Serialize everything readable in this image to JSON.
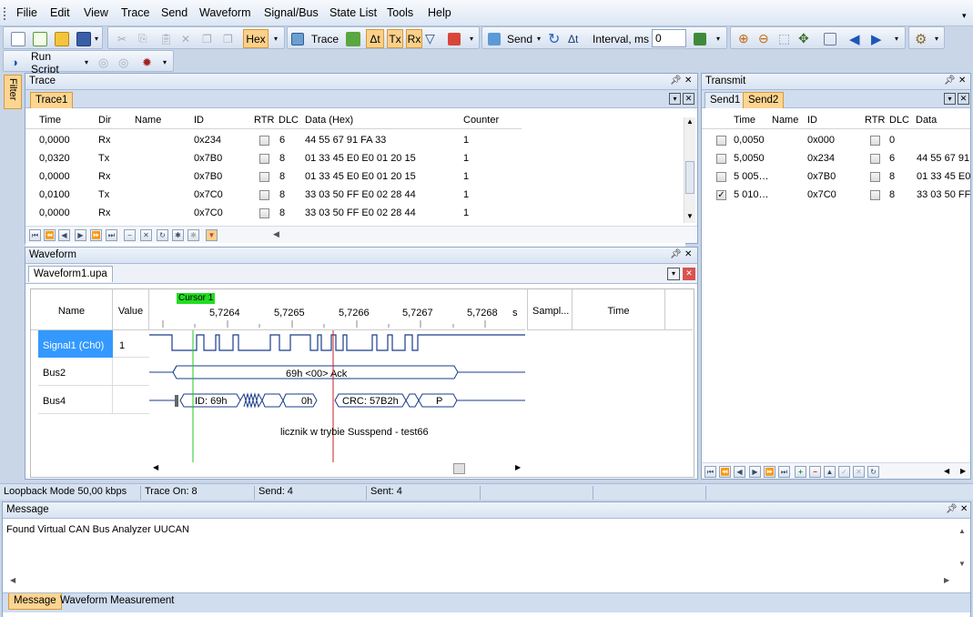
{
  "menu": {
    "items": [
      "Filie",
      "Edit",
      "View",
      "Trace",
      "Send",
      "Waveform",
      "Signal/Bus",
      "State List",
      "Tools",
      "Help"
    ]
  },
  "toolbar": {
    "hex": "Hex",
    "trace": "Trace",
    "tx": "Tx",
    "rx": "Rx",
    "send": "Send",
    "interval_label": "Interval, ms",
    "interval_value": "0",
    "run_script": "Run Script"
  },
  "filter_tab": "Filter",
  "trace_panel": {
    "title": "Trace",
    "tab": "Trace1",
    "columns": [
      "Time",
      "Dir",
      "Name",
      "ID",
      "RTR",
      "DLC",
      "Data (Hex)",
      "Counter"
    ],
    "rows": [
      {
        "time": "0,0000",
        "dir": "Rx",
        "name": "",
        "id": "0x234",
        "dlc": "6",
        "data": "44 55 67 91 FA 33",
        "counter": "1"
      },
      {
        "time": "0,0320",
        "dir": "Tx",
        "name": "",
        "id": "0x7B0",
        "dlc": "8",
        "data": "01 33 45 E0 E0 01 20 15",
        "counter": "1"
      },
      {
        "time": "0,0000",
        "dir": "Rx",
        "name": "",
        "id": "0x7B0",
        "dlc": "8",
        "data": "01 33 45 E0 E0 01 20 15",
        "counter": "1"
      },
      {
        "time": "0,0100",
        "dir": "Tx",
        "name": "",
        "id": "0x7C0",
        "dlc": "8",
        "data": "33 03 50 FF E0 02 28 44",
        "counter": "1"
      },
      {
        "time": "0,0000",
        "dir": "Rx",
        "name": "",
        "id": "0x7C0",
        "dlc": "8",
        "data": "33 03 50 FF E0 02 28 44",
        "counter": "1"
      }
    ]
  },
  "waveform_panel": {
    "title": "Waveform",
    "tab": "Waveform1.upa",
    "cursor": "Cursor 1",
    "col_name": "Name",
    "col_value": "Value",
    "col_sample": "Sampl...",
    "col_time": "Time",
    "ticks": [
      "5,7264",
      "5,7265",
      "5,7266",
      "5,7267",
      "5,7268"
    ],
    "unit": "s",
    "signals": [
      {
        "name": "Signal1 (Ch0)",
        "value": "1"
      },
      {
        "name": "Bus2",
        "value": ""
      },
      {
        "name": "Bus4",
        "value": ""
      }
    ],
    "bus2_label": "69h <00> Ack",
    "bus4_id": "ID: 69h",
    "bus4_data": "0h",
    "bus4_crc": "CRC: 57B2h",
    "bus4_p": "P",
    "note": "licznik w trybie Susspend - test66"
  },
  "transmit_panel": {
    "title": "Transmit",
    "tabs": [
      "Send1",
      "Send2"
    ],
    "columns": [
      "Time",
      "Name",
      "ID",
      "RTR",
      "DLC",
      "Data"
    ],
    "rows": [
      {
        "checked": false,
        "time": "0,0050",
        "name": "",
        "id": "0x000",
        "rtr": false,
        "dlc": "0",
        "data": ""
      },
      {
        "checked": false,
        "time": "5,0050",
        "name": "",
        "id": "0x234",
        "rtr": false,
        "dlc": "6",
        "data": "44 55 67 91"
      },
      {
        "checked": false,
        "time": "5 005…",
        "name": "",
        "id": "0x7B0",
        "rtr": false,
        "dlc": "8",
        "data": "01 33 45 E0"
      },
      {
        "checked": true,
        "time": "5 010…",
        "name": "",
        "id": "0x7C0",
        "rtr": false,
        "dlc": "8",
        "data": "33 03 50 FF"
      }
    ]
  },
  "status": {
    "mode": "Loopback Mode 50,00 kbps",
    "trace_on": "Trace On: 8",
    "send": "Send: 4",
    "sent": "Sent: 4"
  },
  "message_panel": {
    "title": "Message",
    "text": "Found Virtual CAN Bus Analyzer UUCAN",
    "tabs": [
      "Message",
      "Waveform Measurement"
    ]
  },
  "colors": {
    "accent": "#fcd590",
    "selected": "#3399ff",
    "cursor1": "#22c822",
    "cursor2": "#c82020",
    "cursor_label": "#22dd22"
  }
}
